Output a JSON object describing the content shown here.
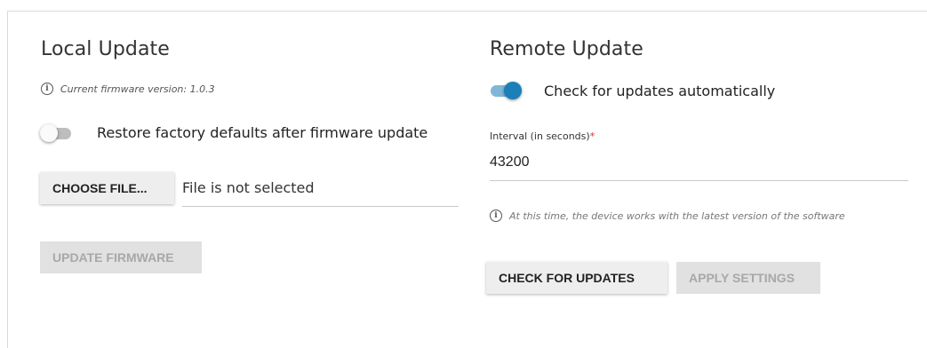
{
  "local_update": {
    "title": "Local Update",
    "firmware_info": "Current firmware version: 1.0.3",
    "restore_toggle": {
      "label": "Restore factory defaults after firmware update",
      "on": false
    },
    "choose_file_label": "CHOOSE FILE...",
    "file_status": "File is not selected",
    "update_firmware_label": "UPDATE FIRMWARE"
  },
  "remote_update": {
    "title": "Remote Update",
    "auto_check_toggle": {
      "label": "Check for updates automatically",
      "on": true
    },
    "interval_label": "Interval (in seconds)",
    "interval_required_mark": "*",
    "interval_value": "43200",
    "status_info": "At this time, the device works with the latest version of the software",
    "check_updates_label": "CHECK FOR UPDATES",
    "apply_settings_label": "APPLY SETTINGS"
  },
  "colors": {
    "accent": "#1b7fb8",
    "accent_track": "#80b7d8",
    "required": "#d0312d",
    "disabled_text": "#a8a8a8"
  }
}
